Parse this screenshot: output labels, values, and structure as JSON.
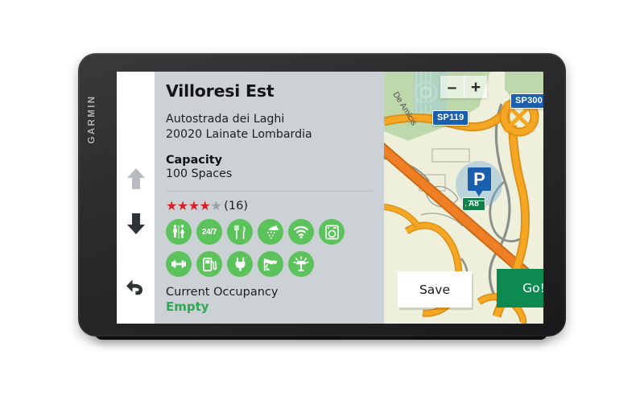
{
  "device": {
    "brand": "GARMIN"
  },
  "rail": {
    "up_label": "scroll-up",
    "down_label": "scroll-down",
    "back_label": "back"
  },
  "poi": {
    "title": "Villoresi Est",
    "address_line1": "Autostrada dei Laghi",
    "address_line2": "20020 Lainate Lombardia",
    "capacity_label": "Capacity",
    "capacity_value": "100 Spaces",
    "rating": {
      "stars_filled": 4,
      "stars_total": 5,
      "count_label": "(16)",
      "star_glyph": "★",
      "filled_color": "#d81f26",
      "empty_color": "#9aa0a6"
    },
    "amenities_row1": [
      {
        "name": "restrooms-icon",
        "label": "Restrooms"
      },
      {
        "name": "open-24-7-icon",
        "label": "24/7"
      },
      {
        "name": "restaurant-icon",
        "label": "Restaurant"
      },
      {
        "name": "shower-icon",
        "label": "Showers"
      },
      {
        "name": "wifi-icon",
        "label": "Wi-Fi"
      },
      {
        "name": "laundry-icon",
        "label": "Laundry"
      }
    ],
    "amenities_row2": [
      {
        "name": "fitness-icon",
        "label": "Fitness"
      },
      {
        "name": "fuel-icon",
        "label": "Fuel"
      },
      {
        "name": "ev-charging-icon",
        "label": "EV Charging"
      },
      {
        "name": "security-camera-icon",
        "label": "Security"
      },
      {
        "name": "lighting-icon",
        "label": "Lighting"
      }
    ],
    "occupancy_label": "Current Occupancy",
    "occupancy_value": "Empty",
    "occupancy_color": "#2fa84f"
  },
  "map": {
    "zoom_out_label": "–",
    "zoom_in_label": "+",
    "shields": [
      {
        "name": "road-shield-sp119",
        "label": "SP119"
      },
      {
        "name": "road-shield-sp300",
        "label": "SP300"
      }
    ],
    "motorway_shield": "A8",
    "parking_marker": "P",
    "street_label": "De Amicis",
    "colors": {
      "background": "#eef0dc",
      "park": "#bdd9ac",
      "motorway": "#f5a623",
      "trunk": "#ef7f24",
      "road_casing": "#8a8f8a",
      "shield_blue": "#1a5fad",
      "shield_green": "#128049"
    }
  },
  "actions": {
    "save_label": "Save",
    "go_label": "Go!"
  }
}
